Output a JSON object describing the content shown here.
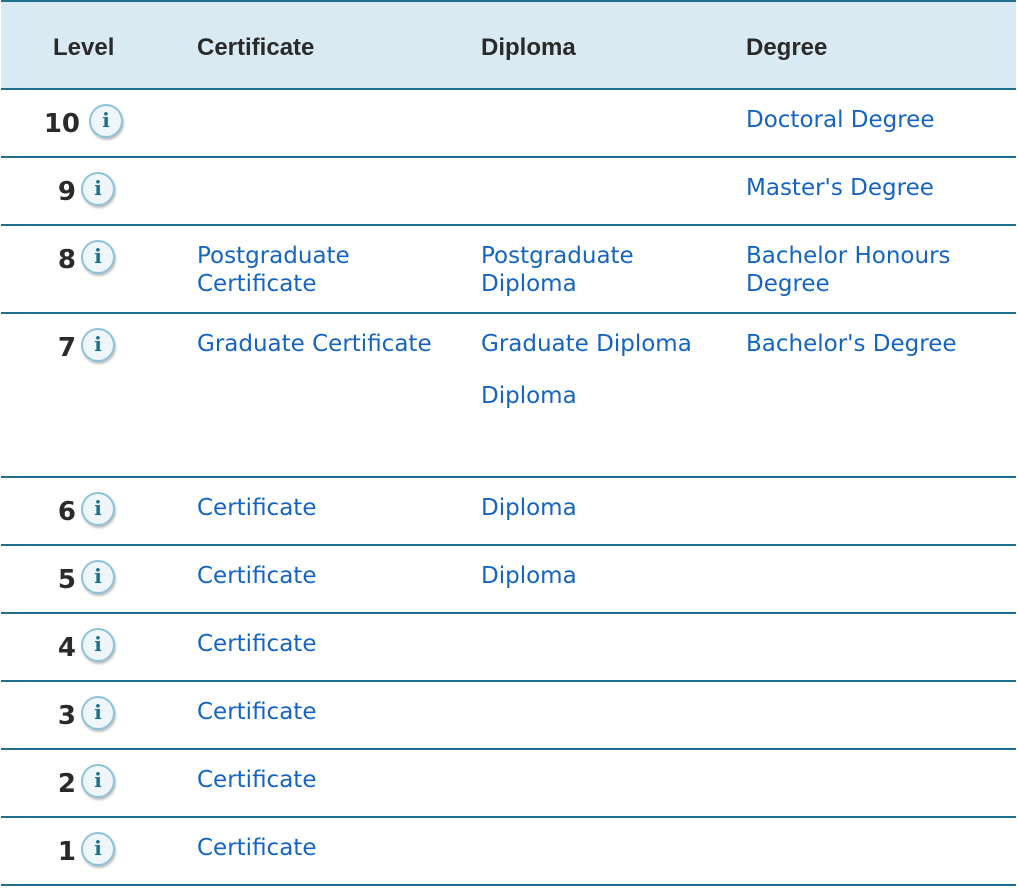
{
  "table": {
    "headers": {
      "level": "Level",
      "certificate": "Certificate",
      "diploma": "Diploma",
      "degree": "Degree"
    },
    "info_glyph": "i",
    "rows": [
      {
        "level": "10",
        "certificate": [],
        "diploma": [],
        "degree": [
          "Doctoral Degree"
        ]
      },
      {
        "level": "9",
        "certificate": [],
        "diploma": [],
        "degree": [
          "Master's Degree"
        ]
      },
      {
        "level": "8",
        "certificate": [
          "Postgraduate Certificate"
        ],
        "diploma": [
          "Postgraduate Diploma"
        ],
        "degree": [
          "Bachelor Honours Degree"
        ]
      },
      {
        "level": "7",
        "certificate": [
          "Graduate Certificate"
        ],
        "diploma": [
          "Graduate Diploma",
          "Diploma"
        ],
        "degree": [
          "Bachelor's Degree"
        ]
      },
      {
        "level": "6",
        "certificate": [
          "Certificate"
        ],
        "diploma": [
          "Diploma"
        ],
        "degree": []
      },
      {
        "level": "5",
        "certificate": [
          "Certificate"
        ],
        "diploma": [
          "Diploma"
        ],
        "degree": []
      },
      {
        "level": "4",
        "certificate": [
          "Certificate"
        ],
        "diploma": [],
        "degree": []
      },
      {
        "level": "3",
        "certificate": [
          "Certificate"
        ],
        "diploma": [],
        "degree": []
      },
      {
        "level": "2",
        "certificate": [
          "Certificate"
        ],
        "diploma": [],
        "degree": []
      },
      {
        "level": "1",
        "certificate": [
          "Certificate"
        ],
        "diploma": [],
        "degree": []
      }
    ]
  },
  "colors": {
    "header_bg": "#d9eaf2",
    "rule": "#1f6e8c",
    "link": "#1565c0",
    "text": "#2a2a2a"
  },
  "icons": {
    "info": "info-icon"
  }
}
